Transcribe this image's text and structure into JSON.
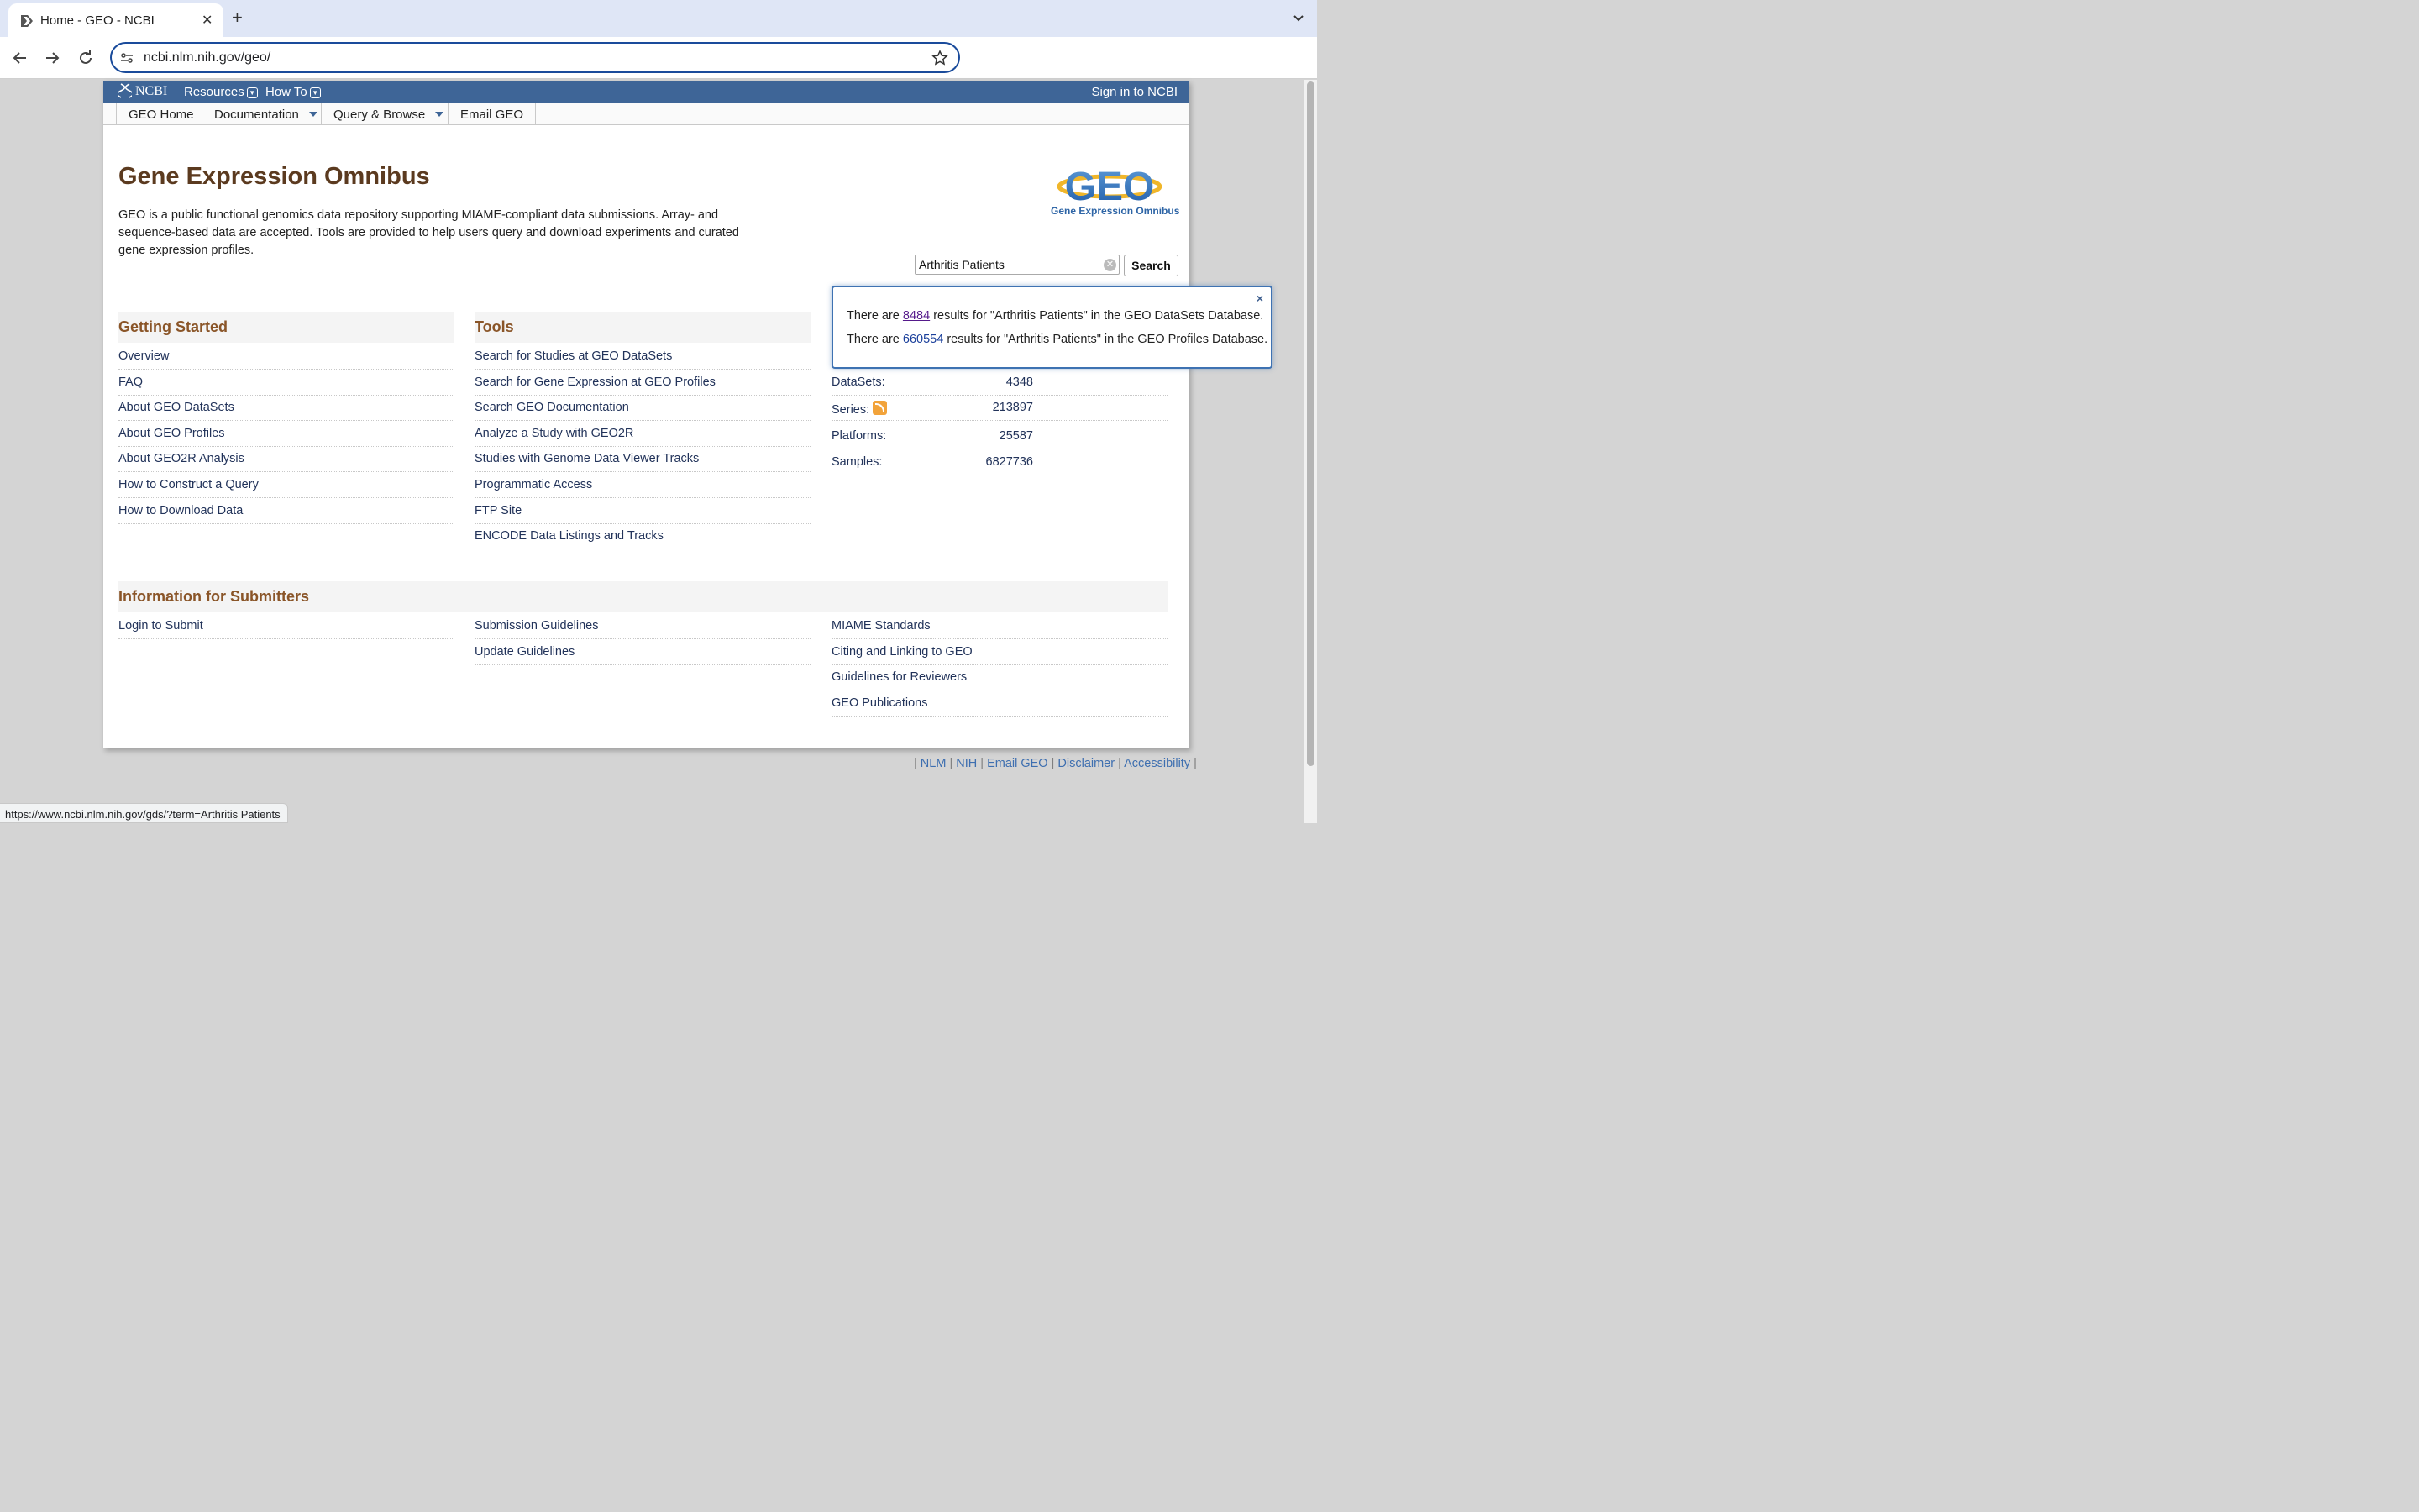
{
  "browser": {
    "tab_title": "Home - GEO - NCBI",
    "new_tab": "+",
    "tab_close": "✕",
    "url": "ncbi.nlm.nih.gov/geo/"
  },
  "ncbi_bar": {
    "logo": "NCBI",
    "resources": "Resources",
    "how_to": "How To",
    "sign_in": "Sign in to NCBI"
  },
  "geo_nav": {
    "home": "GEO Home",
    "documentation": "Documentation",
    "query_browse": "Query & Browse",
    "email": "Email GEO"
  },
  "main": {
    "title": "Gene Expression Omnibus",
    "intro": "GEO is a public functional genomics data repository supporting MIAME-compliant data submissions. Array- and sequence-based data are accepted. Tools are provided to help users query and download experiments and curated gene expression profiles.",
    "logo_text": "GEO",
    "logo_caption": "Gene Expression Omnibus"
  },
  "search": {
    "value": "Arthritis Patients",
    "button": "Search"
  },
  "popup": {
    "close": "×",
    "line1_pre": "There are ",
    "line1_count": "8484",
    "line1_post": " results for \"Arthritis Patients\" in the GEO DataSets Database.",
    "line2_pre": "There are ",
    "line2_count": "660554",
    "line2_post": " results for \"Arthritis Patients\" in the GEO Profiles Database."
  },
  "getting_started": {
    "heading": "Getting Started",
    "links": [
      "Overview",
      "FAQ",
      "About GEO DataSets",
      "About GEO Profiles",
      "About GEO2R Analysis",
      "How to Construct a Query",
      "How to Download Data"
    ]
  },
  "tools": {
    "heading": "Tools",
    "links": [
      "Search for Studies at GEO DataSets",
      "Search for Gene Expression at GEO Profiles",
      "Search GEO Documentation",
      "Analyze a Study with GEO2R",
      "Studies with Genome Data Viewer Tracks",
      "Programmatic Access",
      "FTP Site",
      "ENCODE Data Listings and Tracks"
    ]
  },
  "stats": [
    {
      "label": "DataSets:",
      "value": "4348"
    },
    {
      "label": "Series:",
      "value": "213897"
    },
    {
      "label": "Platforms:",
      "value": "25587"
    },
    {
      "label": "Samples:",
      "value": "6827736"
    }
  ],
  "submitters": {
    "heading": "Information for Submitters",
    "col1": [
      "Login to Submit"
    ],
    "col2": [
      "Submission Guidelines",
      "Update Guidelines"
    ],
    "col3": [
      "MIAME Standards",
      "Citing and Linking to GEO",
      "Guidelines for Reviewers",
      "GEO Publications"
    ]
  },
  "footer": [
    "NLM",
    "NIH",
    "Email GEO",
    "Disclaimer",
    "Accessibility"
  ],
  "status_url": "https://www.ncbi.nlm.nih.gov/gds/?term=Arthritis Patients",
  "colors": {
    "ncbi_bar": "#3e6597",
    "title": "#5b3a1f",
    "section_heading": "#8a5528",
    "link": "#22335a"
  }
}
